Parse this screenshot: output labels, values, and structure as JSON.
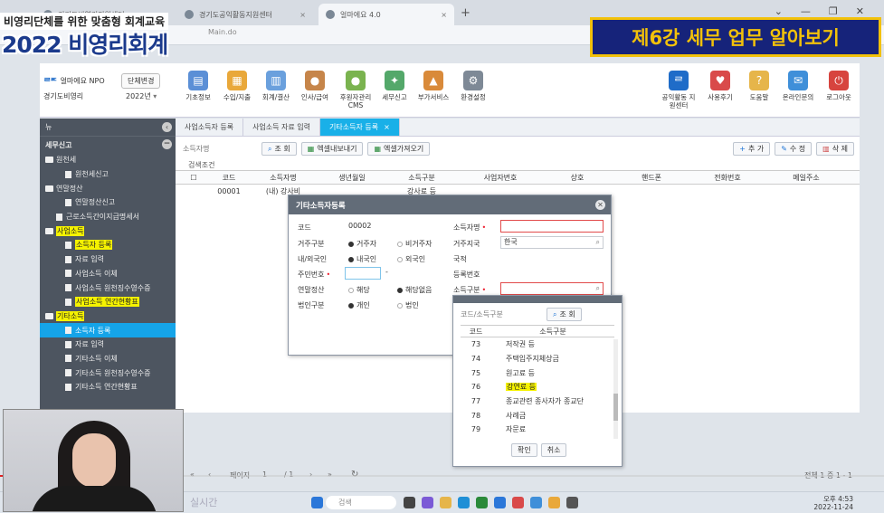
{
  "overlay": {
    "line1": "비영리단체를 위한 맞춤형 회계교육",
    "line2": "2022 비영리회계",
    "lecture_title": "제6강 세무 업무 알아보기"
  },
  "browser": {
    "tabs": [
      {
        "label": "경기도비영리지원센터"
      },
      {
        "label": "경기도공익활동지원센터"
      },
      {
        "label": "얼마에요 4.0"
      }
    ],
    "address": "Main.do"
  },
  "app": {
    "logo": "얼마에요 NPO",
    "dept_button": "단체변경",
    "org_name": "경기도비영리",
    "year": "2022년",
    "menus": [
      "기초정보",
      "수입/지출",
      "회계/결산",
      "인사/급여",
      "후원자관리 CMS",
      "세무신고",
      "부가서비스",
      "환경설정"
    ],
    "right_menus": [
      "공익활동 지원센터",
      "사용후기",
      "도움말",
      "온라인문의",
      "로그아웃"
    ]
  },
  "sidebar": {
    "top_label": "뉴",
    "section": "세무신고",
    "tree": [
      {
        "label": "원천세",
        "type": "folder",
        "level": 0
      },
      {
        "label": "원천세신고",
        "type": "doc",
        "level": 1
      },
      {
        "label": "연말정산",
        "type": "folder",
        "level": 0
      },
      {
        "label": "연말정산신고",
        "type": "doc",
        "level": 1
      },
      {
        "label": "근로소득간이지급명세서",
        "type": "doc",
        "level": 0
      },
      {
        "label": "사업소득",
        "type": "folder",
        "level": 0,
        "highlight": true
      },
      {
        "label": "소득자 등록",
        "type": "doc",
        "level": 1,
        "highlight": true
      },
      {
        "label": "자료 입력",
        "type": "doc",
        "level": 1
      },
      {
        "label": "사업소득 이체",
        "type": "doc",
        "level": 1
      },
      {
        "label": "사업소득 원천징수영수증",
        "type": "doc",
        "level": 1
      },
      {
        "label": "사업소득 연간현황표",
        "type": "doc",
        "level": 1,
        "highlight": true
      },
      {
        "label": "기타소득",
        "type": "folder",
        "level": 0,
        "highlight": true
      },
      {
        "label": "소득자 등록",
        "type": "doc",
        "level": 1,
        "selected": true
      },
      {
        "label": "자료 입력",
        "type": "doc",
        "level": 1
      },
      {
        "label": "기타소득 이체",
        "type": "doc",
        "level": 1
      },
      {
        "label": "기타소득 원천징수영수증",
        "type": "doc",
        "level": 1
      },
      {
        "label": "기타소득 연간현황표",
        "type": "doc",
        "level": 1
      }
    ]
  },
  "main": {
    "tabs": [
      {
        "label": "사업소득자 등록"
      },
      {
        "label": "사업소득 자료 입력"
      },
      {
        "label": "기타소득자 등록",
        "active": true
      }
    ],
    "toolbar": {
      "search_placeholder": "소득자명",
      "search": "조 회",
      "excel_down": "엑셀내보내기",
      "excel_up": "엑셀가져오기",
      "add": "추 가",
      "edit": "수 정",
      "delete": "삭 제"
    },
    "search_cond": "검색조건",
    "columns": [
      "코드",
      "소득자명",
      "생년월일",
      "소득구분",
      "사업자번호",
      "상호",
      "핸드폰",
      "전화번호",
      "메일주소"
    ],
    "rows": [
      [
        "00001",
        "(내) 강사비",
        "",
        "강사료 등",
        "",
        "",
        "",
        "",
        ""
      ]
    ],
    "pager": {
      "page_label": "페이지",
      "page": "1",
      "total_pages": "/ 1",
      "summary": "전체 1 중 1 - 1"
    }
  },
  "dialog": {
    "title": "기타소득자등록",
    "code_label": "코드",
    "code_value": "00002",
    "name_label": "소득자명",
    "resident_label": "거주구분",
    "resident_opts": [
      "거주자",
      "비거주자"
    ],
    "resident_country_label": "거주지국",
    "resident_country_value": "한국",
    "nation_label": "내/외국인",
    "nation_opts": [
      "내국인",
      "외국인"
    ],
    "nationality_label": "국적",
    "idnum_label": "주민번호",
    "bizno_label": "등록번호",
    "yearend_label": "연말정산",
    "yearend_opts": [
      "해당",
      "해당없음"
    ],
    "income_type_label": "소득구분",
    "corp_label": "법인구분",
    "corp_opts": [
      "개인",
      "법인"
    ]
  },
  "dialog2": {
    "search_placeholder": "코드/소득구분",
    "search": "조 회",
    "col_code": "코드",
    "col_type": "소득구분",
    "rows": [
      {
        "code": "73",
        "name": "저작권 등"
      },
      {
        "code": "74",
        "name": "주택입주지체상금"
      },
      {
        "code": "75",
        "name": "원고료 등"
      },
      {
        "code": "76",
        "name": "강연료 등",
        "highlight": true
      },
      {
        "code": "77",
        "name": "종교관련 종사자가 종교단"
      },
      {
        "code": "78",
        "name": "사례금"
      },
      {
        "code": "79",
        "name": "자문료"
      }
    ],
    "ok": "확인",
    "cancel": "취소"
  },
  "taskbar": {
    "search": "검색",
    "time": "오후 4:53",
    "date": "2022-11-24"
  },
  "video": {
    "live": "실시간"
  },
  "colors": {
    "accent": "#19b0e8",
    "sidebar": "#4d5560",
    "highlight": "#f5f200",
    "banner_bg": "#16237a",
    "banner_fg": "#f2c10a"
  }
}
